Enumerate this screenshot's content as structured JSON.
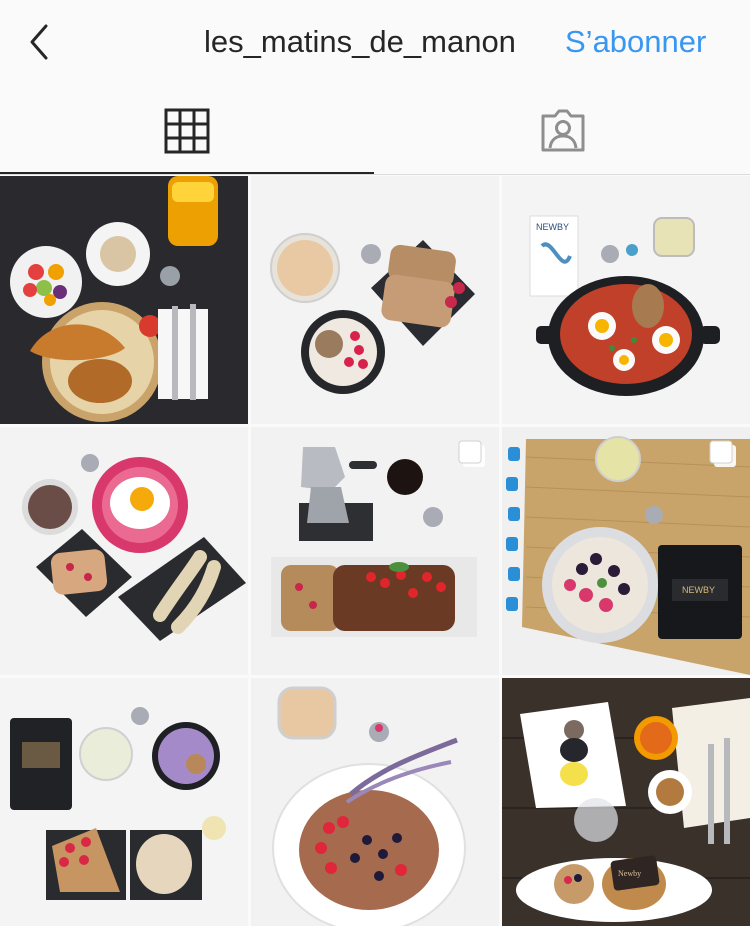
{
  "header": {
    "back_icon": "chevron-left-icon",
    "username": "les_matins_de_manon",
    "follow_label": "S’abonner",
    "follow_color": "#3897f0"
  },
  "tabs": [
    {
      "name": "grid",
      "icon": "grid-icon",
      "active": true
    },
    {
      "name": "tagged",
      "icon": "tagged-person-icon",
      "active": false
    }
  ],
  "posts": [
    {
      "id": "post-1",
      "subject": "croissant-basket-fruit-bowl-coffee-orange-juice",
      "multi": false
    },
    {
      "id": "post-2",
      "subject": "banana-bread-raspberries-granola-bowl-juice",
      "multi": false
    },
    {
      "id": "post-3",
      "subject": "shakshuka-cast-iron-pan-tea",
      "multi": false
    },
    {
      "id": "post-4",
      "subject": "fried-egg-banana-toast-slate",
      "multi": false
    },
    {
      "id": "post-5",
      "subject": "moka-pot-cake-redcurrants",
      "multi": true
    },
    {
      "id": "post-6",
      "subject": "porridge-bowl-berries-tea-bag",
      "multi": true
    },
    {
      "id": "post-7",
      "subject": "tart-slice-bread-yogurt-granola",
      "multi": false
    },
    {
      "id": "post-8",
      "subject": "pancake-berries-lavender-juice",
      "multi": false
    },
    {
      "id": "post-9",
      "subject": "cafe-table-macarons-coffee-sandwich",
      "multi": false
    }
  ],
  "post8_tag": "Newby",
  "tea_brand": "NEWBY"
}
